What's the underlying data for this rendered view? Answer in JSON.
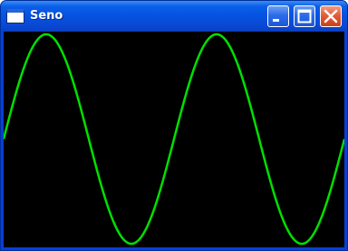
{
  "window": {
    "title": "Seno"
  },
  "icons": {
    "app": "app-window-icon",
    "minimize": "minimize-icon",
    "maximize": "maximize-icon",
    "close": "close-icon"
  },
  "colors": {
    "title_bar": "#0553e1",
    "plot_background": "#000000",
    "curve": "#00e000",
    "close_button": "#e15c38"
  },
  "plot": {
    "function": "sin",
    "cycles_shown": 2
  }
}
